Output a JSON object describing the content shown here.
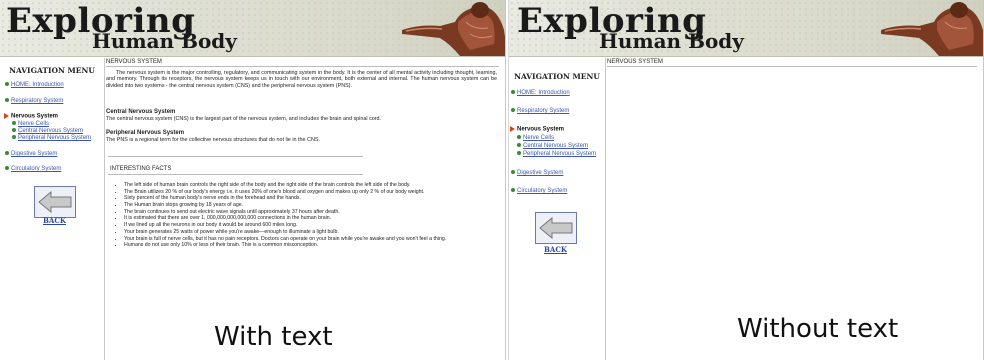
{
  "header": {
    "title_line1": "Exploring",
    "title_line2": "Human Body"
  },
  "nav": {
    "title": "NAVIGATION MENU",
    "home": "HOME: Introduction",
    "respiratory": "Respiratory System",
    "nervous": "Nervous System",
    "nerve_cells": "Nerve Cells",
    "central": "Central Nervous System",
    "peripheral": "Peripheral Nervous System",
    "digestive": "Digestive System",
    "circulatory": "Circulatory System",
    "back": "BACK"
  },
  "content": {
    "section_title": "NERVOUS SYSTEM",
    "intro": "The nervous system is the major controlling, regulatory, and communicating system in the body. It is the center of all mental activity including thought, learning, and memory. Through its receptors, the nervous system keeps us in touch with our environment, both external and internal. The human nervous system can be divided into two systems - the central nervous system (CNS) and the peripheral nervous system (PNS).",
    "central_head": "Central Nervous System",
    "central_text": "The central nervous system (CNS) is the largest part of the nervous system, and includes the brain and spinal cord.",
    "peripheral_head": "Peripheral Nervous System",
    "peripheral_text": "The PNS is a regional term for the collective nervous structures that do not lie in the CNS.",
    "facts_title": "INTERESTING FACTS",
    "facts": [
      "The left side of human brain controls the right side of the body and the right side of the brain controls the left side of the body.",
      "The Brain utilizes 20 % of our body's energy i.e. it uses 20% of one's blood and oxygen and makes up only 2 % of our body weight.",
      "Sixty percent of the human body's nerve ends in the forehead and the hands.",
      "The Human brain stops growing by 18 years of age.",
      "The brain continues to send out electric wave signals until approximately 37 hours after death.",
      "It is estimated that there are over 1, 000,000,000,000,000 connections in the human brain.",
      "If we lined up all the neurons in our body it would be around 600 miles long.",
      "Your brain generates 25 watts of power while you're awake—enough to illuminate a light bulb.",
      "Your brain is full of nerve cells, but it has no pain receptors. Doctors can operate on your brain while you're awake and you won't feel a thing.",
      "Humans do not use only 10% or less of their brain. This is a common misconception."
    ]
  },
  "captions": {
    "with_text": "With text",
    "without_text": "Without text"
  },
  "colors": {
    "link": "#3b57b0",
    "bullet": "#3a8a3a",
    "active_arrow": "#d0461c",
    "header_bg": "#dfe0d4"
  }
}
